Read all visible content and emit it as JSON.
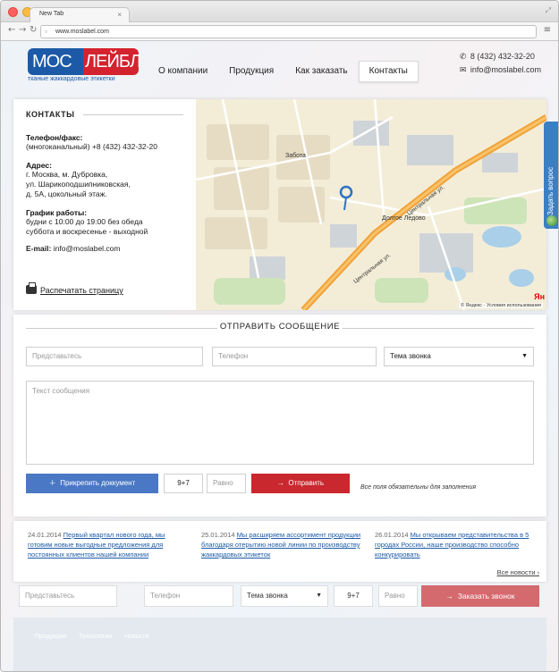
{
  "browser": {
    "tab_title": "New Tab",
    "url": "www.moslabel.com"
  },
  "logo": {
    "part1": "МОС",
    "part2": "ЛЕЙБЛ",
    "tagline": "тканые жаккардовые этикетки"
  },
  "nav": {
    "items": [
      {
        "label": "О компании"
      },
      {
        "label": "Продукция"
      },
      {
        "label": "Как заказать"
      },
      {
        "label": "Контакты"
      }
    ]
  },
  "header_contacts": {
    "phone": "8 (432) 432-32-20",
    "email": "info@moslabel.com"
  },
  "contacts": {
    "title": "КОНТАКТЫ",
    "phone_label": "Телефон/факс:",
    "phone_value": "(многоканальный) +8 (432) 432-32-20",
    "address_label": "Адрес:",
    "address_line1": "г. Москва, м. Дубровка,",
    "address_line2": "ул. Шарикоподшипниковская,",
    "address_line3": "д. 5А, цокольный этаж.",
    "schedule_label": "График работы:",
    "schedule_line1": "будни с 10:00 до 19:00 без обеда",
    "schedule_line2": "суббота и воскресенье - выходной",
    "email_label": "E-mail:",
    "email_value": "info@moslabel.com",
    "print_label": "Распечатать страницу"
  },
  "map": {
    "copyright": "© Яндекс · Условия использования",
    "logo": "Ян",
    "labels": {
      "zabota": "Забота",
      "dolgoe": "Долгое Ледово",
      "central1": "Центральная ул.",
      "central2": "Центральная ул."
    }
  },
  "side_tab": {
    "label": "Задать вопрос"
  },
  "form": {
    "title": "ОТПРАВИТЬ СООБЩЕНИЕ",
    "name_placeholder": "Представьтесь",
    "phone_placeholder": "Телефон",
    "topic": "Тема звонка",
    "message_placeholder": "Текст сообщения",
    "attach_label": "Прикрепить доккумент",
    "captcha_question": "9+7",
    "captcha_placeholder": "Равно",
    "submit_label": "Отправить",
    "required_note": "Все поля обязательны для заполнения"
  },
  "news": {
    "items": [
      {
        "date": "24.01.2014",
        "text": "Первый квартал нового года, мы готовим новые выгодные предложения для постоянных клиентов нашей компании"
      },
      {
        "date": "25.01.2014",
        "text": "Мы расширяем ассортимент продукции благодаря отерытию новой линии по производству жаккардовых этикеток"
      },
      {
        "date": "26.01.2014",
        "text": "Мы открываем представительства в 5 городах России, наше производство способно конкурировать"
      }
    ],
    "all_label": "Все новости"
  },
  "callback": {
    "name_placeholder": "Представьтесь",
    "phone_placeholder": "Телефон",
    "topic": "Тема звонка",
    "captcha_question": "9+7",
    "captcha_placeholder": "Равно",
    "button_label": "Заказать звонок"
  },
  "footer": {
    "items": [
      {
        "label": "Продукция"
      },
      {
        "label": "Технологии"
      },
      {
        "label": "Новости"
      }
    ]
  }
}
